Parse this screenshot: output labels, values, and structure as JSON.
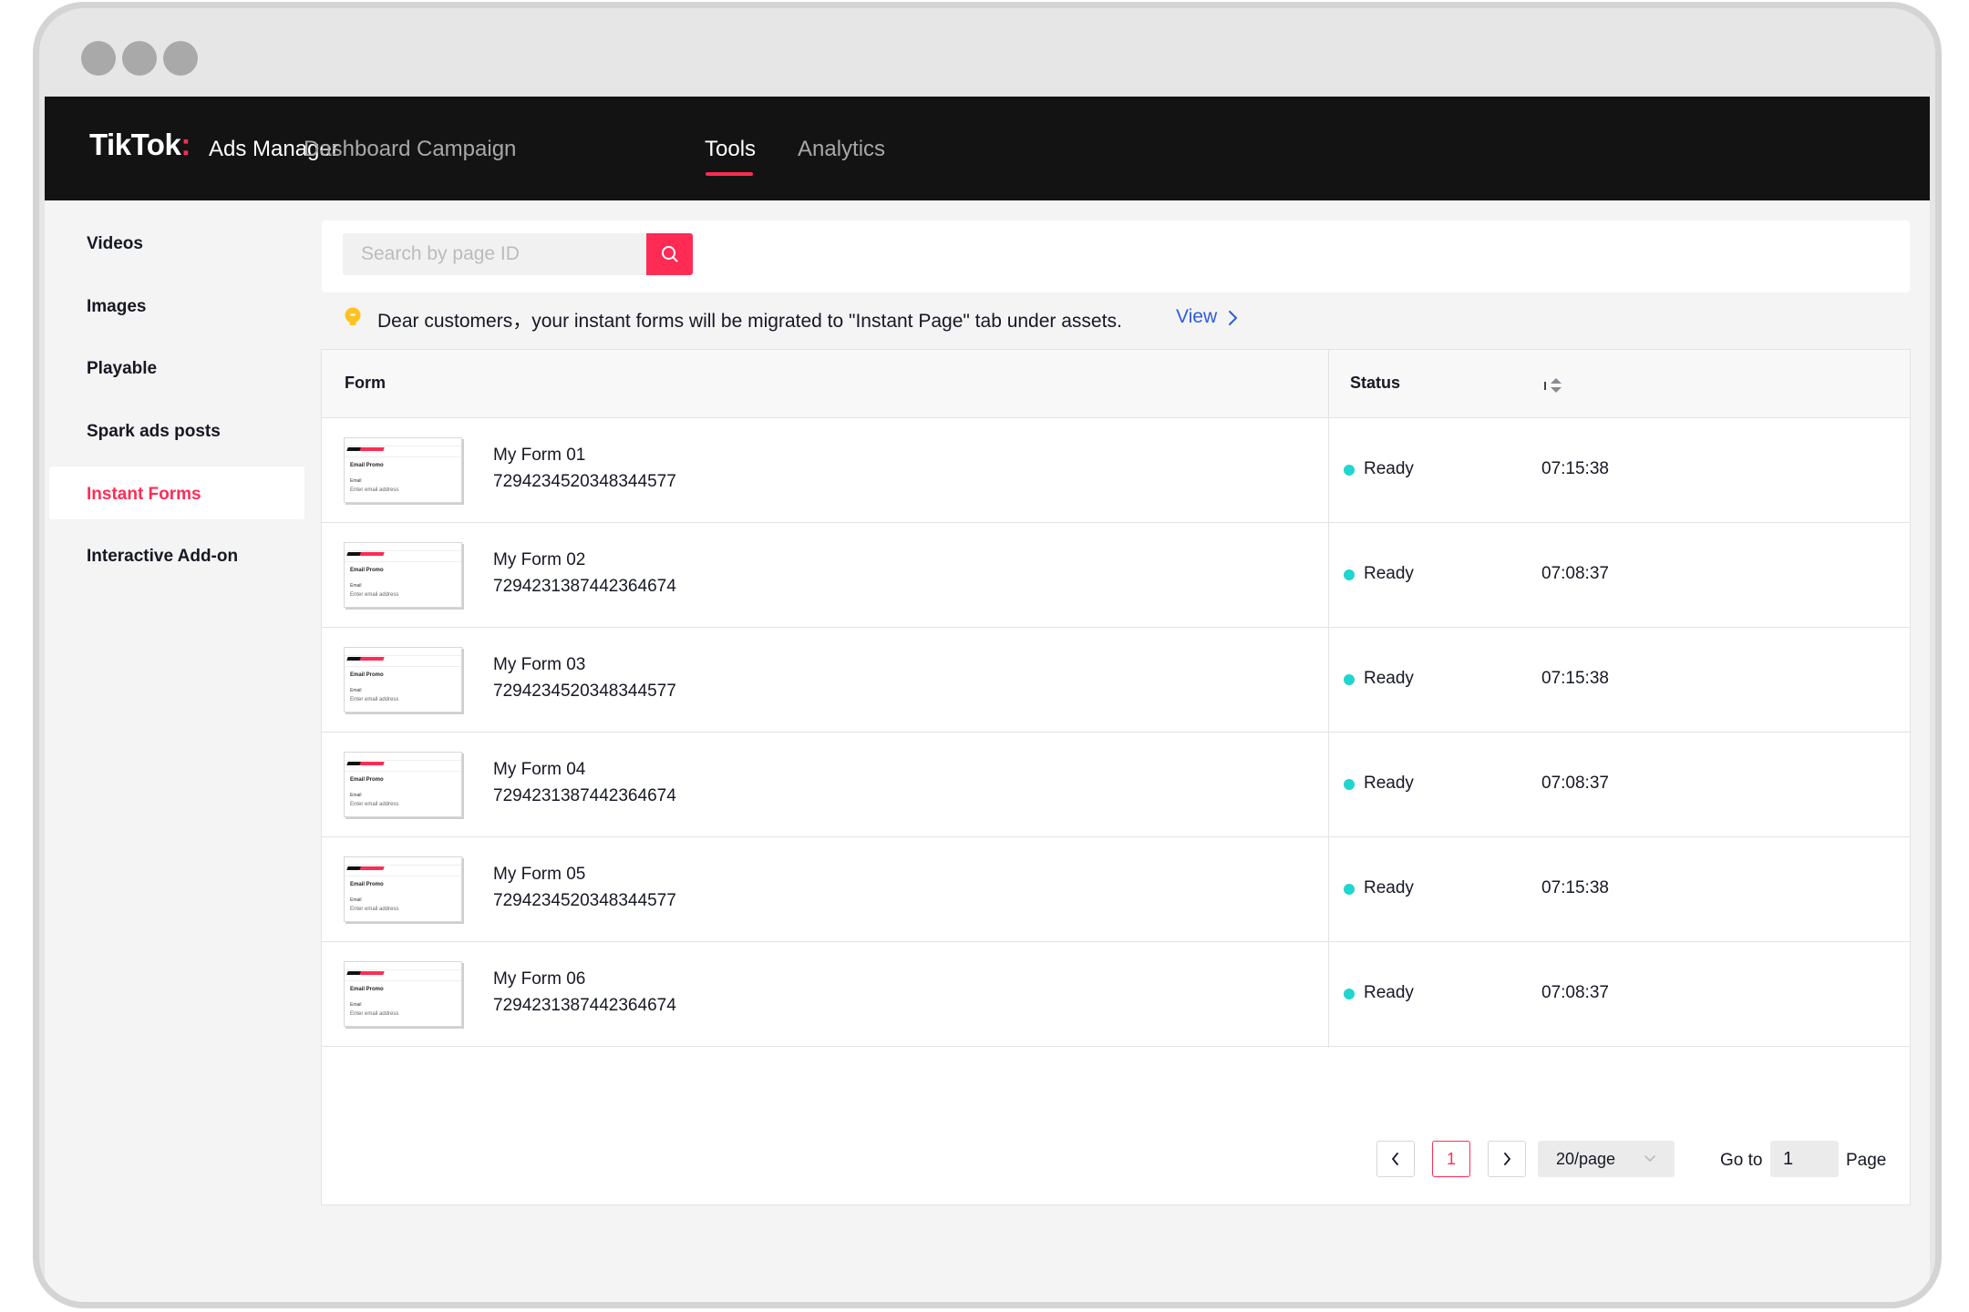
{
  "topnav": {
    "brand": "TikTok",
    "brand_colon": ":",
    "product": "Ads Manager",
    "items": [
      {
        "label": "Dashboard",
        "active": false
      },
      {
        "label": "Campaign",
        "active": false
      },
      {
        "label": "Tools",
        "active": true
      },
      {
        "label": "Analytics",
        "active": false
      }
    ]
  },
  "sidebar": {
    "items": [
      {
        "label": "Videos",
        "active": false
      },
      {
        "label": "Images",
        "active": false
      },
      {
        "label": "Playable",
        "active": false
      },
      {
        "label": "Spark ads posts",
        "active": false
      },
      {
        "label": "Instant Forms",
        "active": true
      },
      {
        "label": "Interactive Add-on",
        "active": false
      }
    ]
  },
  "search": {
    "placeholder": "Search by page ID",
    "value": ""
  },
  "notice": {
    "text": "Dear customers，your instant forms will be migrated to \"Instant Page\" tab under assets.",
    "link": "View"
  },
  "table": {
    "columns": {
      "form": "Form",
      "status": "Status"
    },
    "thumbnail": {
      "title": "Email Promo",
      "field_label": "Email",
      "field_placeholder": "Enter email address"
    },
    "rows": [
      {
        "name": "My Form 01",
        "id": "7294234520348344577",
        "status": "Ready",
        "time": "07:15:38"
      },
      {
        "name": "My Form 02",
        "id": "7294231387442364674",
        "status": "Ready",
        "time": "07:08:37"
      },
      {
        "name": "My Form 03",
        "id": "7294234520348344577",
        "status": "Ready",
        "time": "07:15:38"
      },
      {
        "name": "My Form 04",
        "id": "7294231387442364674",
        "status": "Ready",
        "time": "07:08:37"
      },
      {
        "name": "My Form 05",
        "id": "7294234520348344577",
        "status": "Ready",
        "time": "07:15:38"
      },
      {
        "name": "My Form 06",
        "id": "7294231387442364674",
        "status": "Ready",
        "time": "07:08:37"
      }
    ]
  },
  "pagination": {
    "current_page": "1",
    "page_size": "20/page",
    "goto_label": "Go to",
    "goto_value": "1",
    "page_label": "Page"
  },
  "colors": {
    "accent": "#fe2c55",
    "status_ready": "#20d5cf",
    "link": "#2b5de0",
    "nav_bg": "#131313"
  }
}
